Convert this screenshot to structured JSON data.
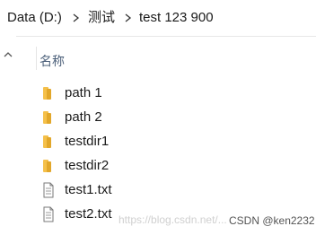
{
  "breadcrumb": {
    "items": [
      "Data (D:)",
      "测试",
      "test 123 900"
    ]
  },
  "file_list": {
    "column_header": "名称",
    "items": [
      {
        "name": "path 1",
        "icon": "folder-icon"
      },
      {
        "name": "path 2",
        "icon": "folder-icon"
      },
      {
        "name": "testdir1",
        "icon": "folder-icon"
      },
      {
        "name": "testdir2",
        "icon": "folder-icon"
      },
      {
        "name": "test1.txt",
        "icon": "text-file-icon"
      },
      {
        "name": "test2.txt",
        "icon": "text-file-icon"
      }
    ]
  },
  "watermark": {
    "url": "https://blog.csdn.net/...",
    "author": "CSDN @ken2232"
  },
  "colors": {
    "folder": "#f5c04a",
    "folder_dark": "#e2a72a",
    "header_text": "#4c607a"
  }
}
